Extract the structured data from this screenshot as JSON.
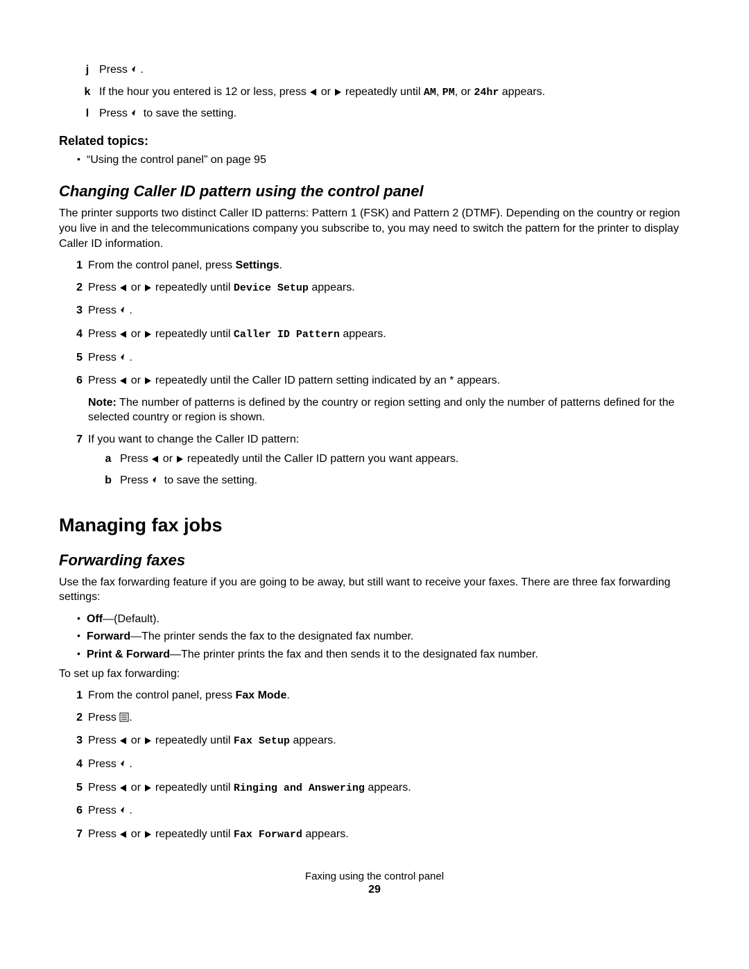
{
  "top_steps": {
    "j": {
      "marker": "j",
      "press": "Press ",
      "dot": "."
    },
    "k": {
      "marker": "k",
      "t1": "If the hour you entered is 12 or less, press ",
      "or": " or ",
      "t2": " repeatedly until ",
      "am": "AM",
      "c1": ", ",
      "pm": "PM",
      "c2": ", or ",
      "hr": "24hr",
      "t3": " appears."
    },
    "l": {
      "marker": "l",
      "press": "Press ",
      "rest": " to save the setting."
    }
  },
  "related": {
    "heading": "Related topics:",
    "item": "“Using the control panel” on page 95"
  },
  "caller_id": {
    "heading": "Changing Caller ID pattern using the control panel",
    "para": "The printer supports two distinct Caller ID patterns: Pattern 1 (FSK) and Pattern 2 (DTMF). Depending on the country or region you live in and the telecommunications company you subscribe to, you may need to switch the pattern for the printer to display Caller ID information.",
    "steps": {
      "s1": {
        "m": "1",
        "t1": "From the control panel, press ",
        "b": "Settings",
        "t2": "."
      },
      "s2": {
        "m": "2",
        "t1": "Press ",
        "or": " or ",
        "t2": " repeatedly until ",
        "code": "Device Setup",
        "t3": " appears."
      },
      "s3": {
        "m": "3",
        "t1": "Press ",
        "dot": "."
      },
      "s4": {
        "m": "4",
        "t1": "Press ",
        "or": " or ",
        "t2": " repeatedly until ",
        "code": "Caller ID Pattern",
        "t3": " appears."
      },
      "s5": {
        "m": "5",
        "t1": "Press ",
        "dot": "."
      },
      "s6": {
        "m": "6",
        "t1": "Press ",
        "or": " or ",
        "t2": " repeatedly until the Caller ID pattern setting indicated by an * appears.",
        "note_label": "Note:",
        "note": " The number of patterns is defined by the country or region setting and only the number of patterns defined for the selected country or region is shown."
      },
      "s7": {
        "m": "7",
        "t1": "If you want to change the Caller ID pattern:",
        "a": {
          "m": "a",
          "t1": "Press ",
          "or": " or ",
          "t2": " repeatedly until the Caller ID pattern you want appears."
        },
        "b": {
          "m": "b",
          "t1": "Press ",
          "t2": " to save the setting."
        }
      }
    }
  },
  "managing": {
    "heading": "Managing fax jobs"
  },
  "forwarding": {
    "heading": "Forwarding faxes",
    "para": "Use the fax forwarding feature if you are going to be away, but still want to receive your faxes. There are three fax forwarding settings:",
    "bullets": {
      "b1": {
        "b": "Off",
        "t": "—(Default)."
      },
      "b2": {
        "b": "Forward",
        "t": "—The printer sends the fax to the designated fax number."
      },
      "b3": {
        "b": "Print & Forward",
        "t": "—The printer prints the fax and then sends it to the designated fax number."
      }
    },
    "setup_line": "To set up fax forwarding:",
    "steps": {
      "s1": {
        "m": "1",
        "t1": "From the control panel, press ",
        "b": "Fax Mode",
        "t2": "."
      },
      "s2": {
        "m": "2",
        "t1": "Press ",
        "dot": "."
      },
      "s3": {
        "m": "3",
        "t1": "Press ",
        "or": " or ",
        "t2": " repeatedly until ",
        "code": "Fax Setup",
        "t3": " appears."
      },
      "s4": {
        "m": "4",
        "t1": "Press ",
        "dot": "."
      },
      "s5": {
        "m": "5",
        "t1": "Press ",
        "or": " or ",
        "t2": " repeatedly until ",
        "code": "Ringing and Answering",
        "t3": " appears."
      },
      "s6": {
        "m": "6",
        "t1": "Press ",
        "dot": "."
      },
      "s7": {
        "m": "7",
        "t1": "Press ",
        "or": " or ",
        "t2": " repeatedly until ",
        "code": " Fax Forward",
        "t3": " appears."
      }
    }
  },
  "footer": {
    "title": "Faxing using the control panel",
    "page": "29"
  }
}
